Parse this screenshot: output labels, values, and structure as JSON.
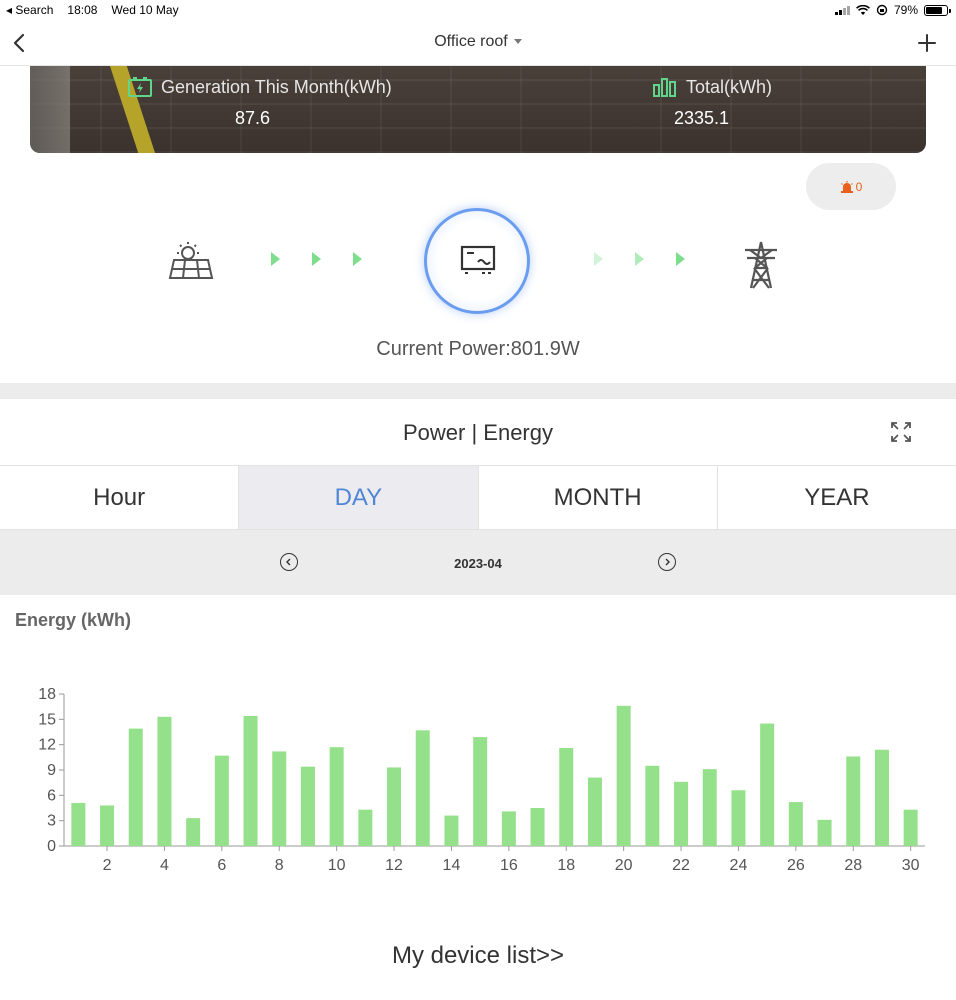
{
  "status_bar": {
    "back_app": "Search",
    "time": "18:08",
    "date": "Wed 10 May",
    "battery_percent": "79%",
    "battery_level": 0.79
  },
  "nav": {
    "title": "Office roof"
  },
  "banner": {
    "generation_label": "Generation This Month(kWh)",
    "generation_value": "87.6",
    "total_label": "Total(kWh)",
    "total_value": "2335.1"
  },
  "alarm": {
    "count": "0"
  },
  "power_flow": {
    "current_power_text": "Current Power:801.9W"
  },
  "section": {
    "title": "Power | Energy"
  },
  "tabs": [
    {
      "label": "Hour",
      "active": false
    },
    {
      "label": "DAY",
      "active": true
    },
    {
      "label": "MONTH",
      "active": false
    },
    {
      "label": "YEAR",
      "active": false
    }
  ],
  "date_nav": {
    "current": "2023-04"
  },
  "chart_data": {
    "type": "bar",
    "title": "",
    "ylabel": "Energy (kWh)",
    "xlabel": "",
    "ylim": [
      0,
      18
    ],
    "yticks": [
      0,
      3,
      6,
      9,
      12,
      15,
      18
    ],
    "xticks": [
      2,
      4,
      6,
      8,
      10,
      12,
      14,
      16,
      18,
      20,
      22,
      24,
      26,
      28,
      30
    ],
    "categories": [
      1,
      2,
      3,
      4,
      5,
      6,
      7,
      8,
      9,
      10,
      11,
      12,
      13,
      14,
      15,
      16,
      17,
      18,
      19,
      20,
      21,
      22,
      23,
      24,
      25,
      26,
      27,
      28,
      29,
      30
    ],
    "values": [
      5.1,
      4.8,
      13.9,
      15.3,
      3.3,
      10.7,
      15.4,
      11.2,
      9.4,
      11.7,
      4.3,
      9.3,
      13.7,
      3.6,
      12.9,
      4.1,
      4.5,
      11.6,
      8.1,
      16.6,
      9.5,
      7.6,
      9.1,
      6.6,
      14.5,
      5.2,
      3.1,
      10.6,
      11.4,
      4.3
    ],
    "bar_color": "#95e08a",
    "grid": false
  },
  "footer": {
    "device_link": "My device list>>"
  },
  "colors": {
    "accent": "#4f86d6",
    "flow_green": "#7fde8e",
    "alarm_orange": "#e8601c"
  },
  "icons": {
    "solar": "solar-panel-icon",
    "inverter": "inverter-icon",
    "grid": "power-tower-icon"
  }
}
